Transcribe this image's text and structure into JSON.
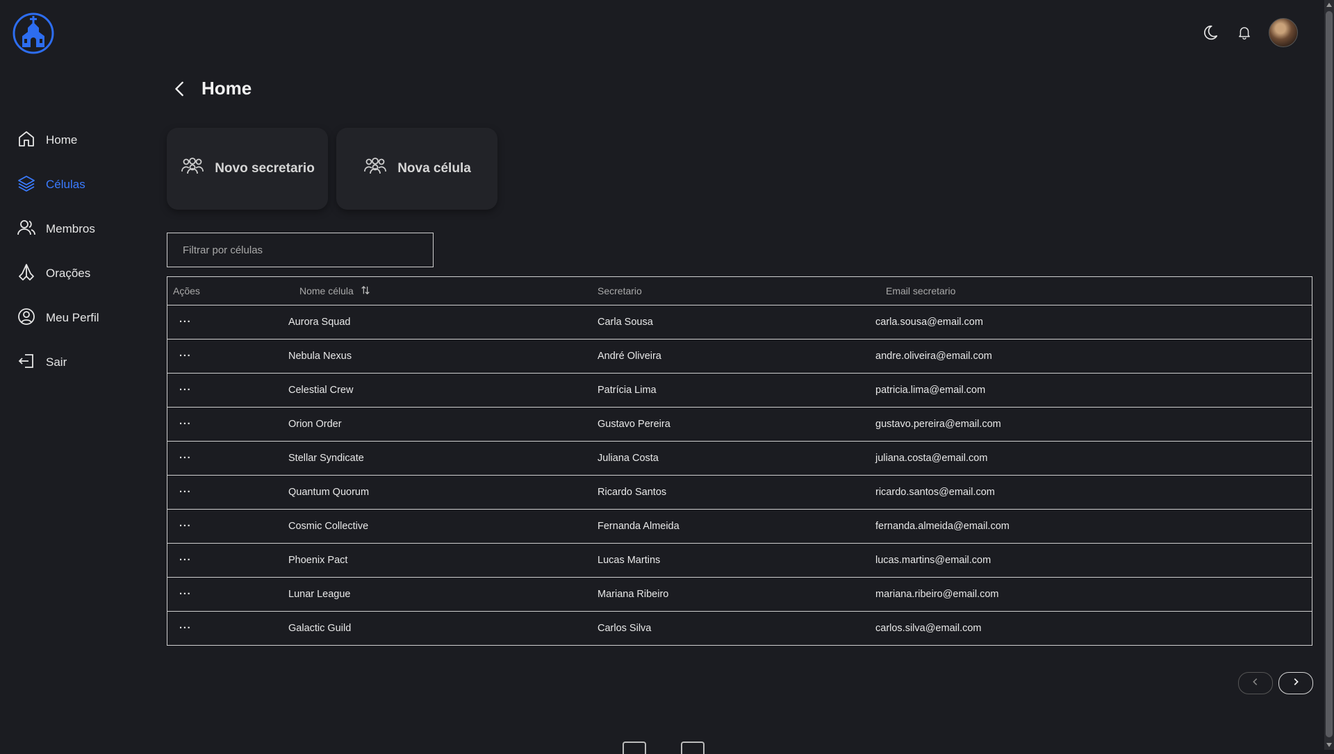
{
  "colors": {
    "background": "#1b1c21",
    "accent": "#3a7bff",
    "text": "#e6e6e6"
  },
  "topbar": {
    "logo_icon": "church-icon",
    "icons": [
      "moon-icon",
      "bell-icon",
      "avatar"
    ]
  },
  "sidebar": {
    "items": [
      {
        "label": "Home",
        "icon": "home-icon",
        "active": false
      },
      {
        "label": "Células",
        "icon": "layers-icon",
        "active": true
      },
      {
        "label": "Membros",
        "icon": "users-icon",
        "active": false
      },
      {
        "label": "Orações",
        "icon": "praying-hands-icon",
        "active": false
      },
      {
        "label": "Meu Perfil",
        "icon": "user-circle-icon",
        "active": false
      },
      {
        "label": "Sair",
        "icon": "logout-icon",
        "active": false
      }
    ]
  },
  "header": {
    "title": "Home"
  },
  "actions": {
    "new_secretary": "Novo secretario",
    "new_cell": "Nova célula"
  },
  "filter": {
    "placeholder": "Filtrar por células",
    "value": ""
  },
  "table": {
    "columns": {
      "acoes": "Ações",
      "nome": "Nome célula",
      "secretario": "Secretario",
      "email": "Email secretario"
    },
    "action_label": "···",
    "rows": [
      {
        "nome": "Aurora Squad",
        "secretario": "Carla Sousa",
        "email": "carla.sousa@email.com"
      },
      {
        "nome": "Nebula Nexus",
        "secretario": "André Oliveira",
        "email": "andre.oliveira@email.com"
      },
      {
        "nome": "Celestial Crew",
        "secretario": "Patrícia Lima",
        "email": "patricia.lima@email.com"
      },
      {
        "nome": "Orion Order",
        "secretario": "Gustavo Pereira",
        "email": "gustavo.pereira@email.com"
      },
      {
        "nome": "Stellar Syndicate",
        "secretario": "Juliana Costa",
        "email": "juliana.costa@email.com"
      },
      {
        "nome": "Quantum Quorum",
        "secretario": "Ricardo Santos",
        "email": "ricardo.santos@email.com"
      },
      {
        "nome": "Cosmic Collective",
        "secretario": "Fernanda Almeida",
        "email": "fernanda.almeida@email.com"
      },
      {
        "nome": "Phoenix Pact",
        "secretario": "Lucas Martins",
        "email": "lucas.martins@email.com"
      },
      {
        "nome": "Lunar League",
        "secretario": "Mariana Ribeiro",
        "email": "mariana.ribeiro@email.com"
      },
      {
        "nome": "Galactic Guild",
        "secretario": "Carlos Silva",
        "email": "carlos.silva@email.com"
      }
    ]
  }
}
